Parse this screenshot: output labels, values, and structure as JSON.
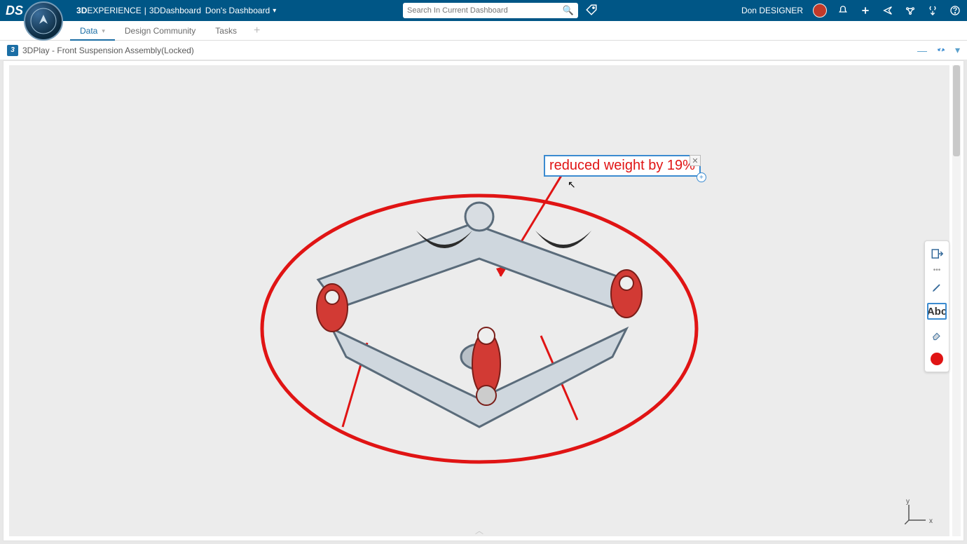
{
  "header": {
    "brand_bold": "3D",
    "brand_rest": "EXPERIENCE",
    "product": "3DDashboard",
    "dashboard_name": "Don's Dashboard",
    "search_placeholder": "Search In Current Dashboard",
    "user_name": "Don DESIGNER"
  },
  "tabs": [
    {
      "label": "Data",
      "active": true,
      "dropdown": true
    },
    {
      "label": "Design Community",
      "active": false,
      "dropdown": false
    },
    {
      "label": "Tasks",
      "active": false,
      "dropdown": false
    }
  ],
  "widget": {
    "app": "3DPlay",
    "title": "Front Suspension Assembly(Locked)"
  },
  "annotation": {
    "text": "reduced weight by 19%"
  },
  "side_tools": {
    "text_label": "Abc"
  },
  "axes": {
    "y": "y",
    "x": "x"
  },
  "colors": {
    "accent": "#005686",
    "markup": "#e01414",
    "select": "#3b8bd0"
  }
}
